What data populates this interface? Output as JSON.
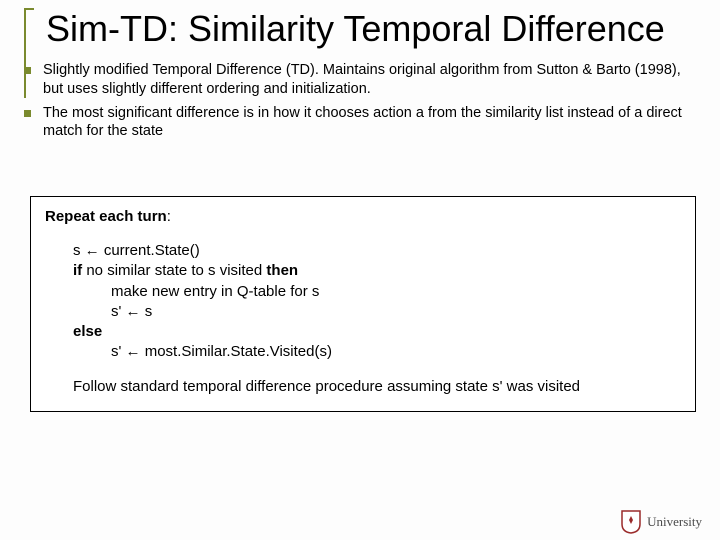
{
  "title": "Sim-TD: Similarity Temporal Difference",
  "bullets": [
    "Slightly modified Temporal Difference (TD).  Maintains original algorithm from Sutton & Barto (1998), but uses slightly different ordering and initialization.",
    "The most significant difference is in how it chooses action a from the similarity list instead of a direct match for the state"
  ],
  "algo": {
    "heading_prefix": "Repeat each turn",
    "heading_colon": ":",
    "l1_pre": "s ",
    "arrow": "←",
    "l1_post": "  current.State()",
    "l2_if": "if",
    "l2_mid": "  no similar state to s visited ",
    "l2_then": "then",
    "l3": "make new entry in Q-table for s",
    "l4_pre": "s' ",
    "l4_post": " s",
    "l5_else": "else",
    "l6_pre": "s' ",
    "l6_post": " most.Similar.State.Visited(s)",
    "follow": "Follow standard temporal difference procedure assuming state s' was visited"
  },
  "logo_text": "University"
}
